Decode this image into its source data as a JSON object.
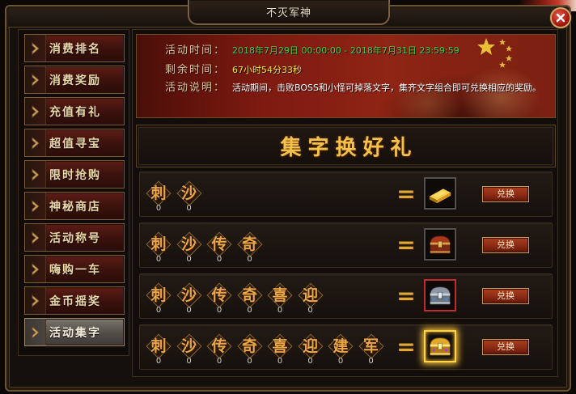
{
  "window": {
    "title": "不灭军神",
    "close_icon": "close-icon"
  },
  "sidebar": {
    "chevron_icon": "chevron-right-icon",
    "selected_index": 9,
    "items": [
      {
        "label": "消费排名"
      },
      {
        "label": "消费奖励"
      },
      {
        "label": "充值有礼"
      },
      {
        "label": "超值寻宝"
      },
      {
        "label": "限时抢购"
      },
      {
        "label": "神秘商店"
      },
      {
        "label": "活动称号"
      },
      {
        "label": "嗨购一车"
      },
      {
        "label": "金币摇奖"
      },
      {
        "label": "活动集字"
      }
    ]
  },
  "event_info": {
    "time_label": "活动时间：",
    "time_value": "2018年7月29日 00:00:00 - 2018年7月31日 23:59:59",
    "remaining_label": "剩余时间：",
    "remaining_value": "67小时54分33秒",
    "desc_label": "活动说明：",
    "desc_value": "活动期间，击败BOSS和小怪可掉落文字，集齐文字组合即可兑换相应的奖励。"
  },
  "section_title": "集字换好礼",
  "exchange": {
    "equals_sign": "=",
    "rows": [
      {
        "chars": [
          {
            "char": "刺",
            "count": "0"
          },
          {
            "char": "沙",
            "count": "0"
          }
        ],
        "reward_icon": "gold-bar-icon",
        "reward_frame_color": "#55504a",
        "button_label": "兑换"
      },
      {
        "chars": [
          {
            "char": "刺",
            "count": "0"
          },
          {
            "char": "沙",
            "count": "0"
          },
          {
            "char": "传",
            "count": "0"
          },
          {
            "char": "奇",
            "count": "0"
          }
        ],
        "reward_icon": "red-treasure-chest-icon",
        "reward_frame_color": "#55504a",
        "button_label": "兑换"
      },
      {
        "chars": [
          {
            "char": "刺",
            "count": "0"
          },
          {
            "char": "沙",
            "count": "0"
          },
          {
            "char": "传",
            "count": "0"
          },
          {
            "char": "奇",
            "count": "0"
          },
          {
            "char": "喜",
            "count": "0"
          },
          {
            "char": "迎",
            "count": "0"
          }
        ],
        "reward_icon": "silver-treasure-chest-icon",
        "reward_frame_color": "#c42a2a",
        "button_label": "兑换"
      },
      {
        "chars": [
          {
            "char": "刺",
            "count": "0"
          },
          {
            "char": "沙",
            "count": "0"
          },
          {
            "char": "传",
            "count": "0"
          },
          {
            "char": "奇",
            "count": "0"
          },
          {
            "char": "喜",
            "count": "0"
          },
          {
            "char": "迎",
            "count": "0"
          },
          {
            "char": "建",
            "count": "0"
          },
          {
            "char": "军",
            "count": "0"
          }
        ],
        "reward_icon": "golden-treasure-chest-icon",
        "reward_frame_color": "#ffd24a",
        "reward_glow_color": "#ffc83a",
        "button_label": "兑换"
      }
    ]
  },
  "colors": {
    "label": "#d8c79c",
    "time_value": "#3ccf3f",
    "remaining_value": "#e6e54c",
    "desc_value": "#ffffff",
    "title_gold": "#f2c24c",
    "char_gold": "#e9a648",
    "button_red": "#8c2a14"
  }
}
